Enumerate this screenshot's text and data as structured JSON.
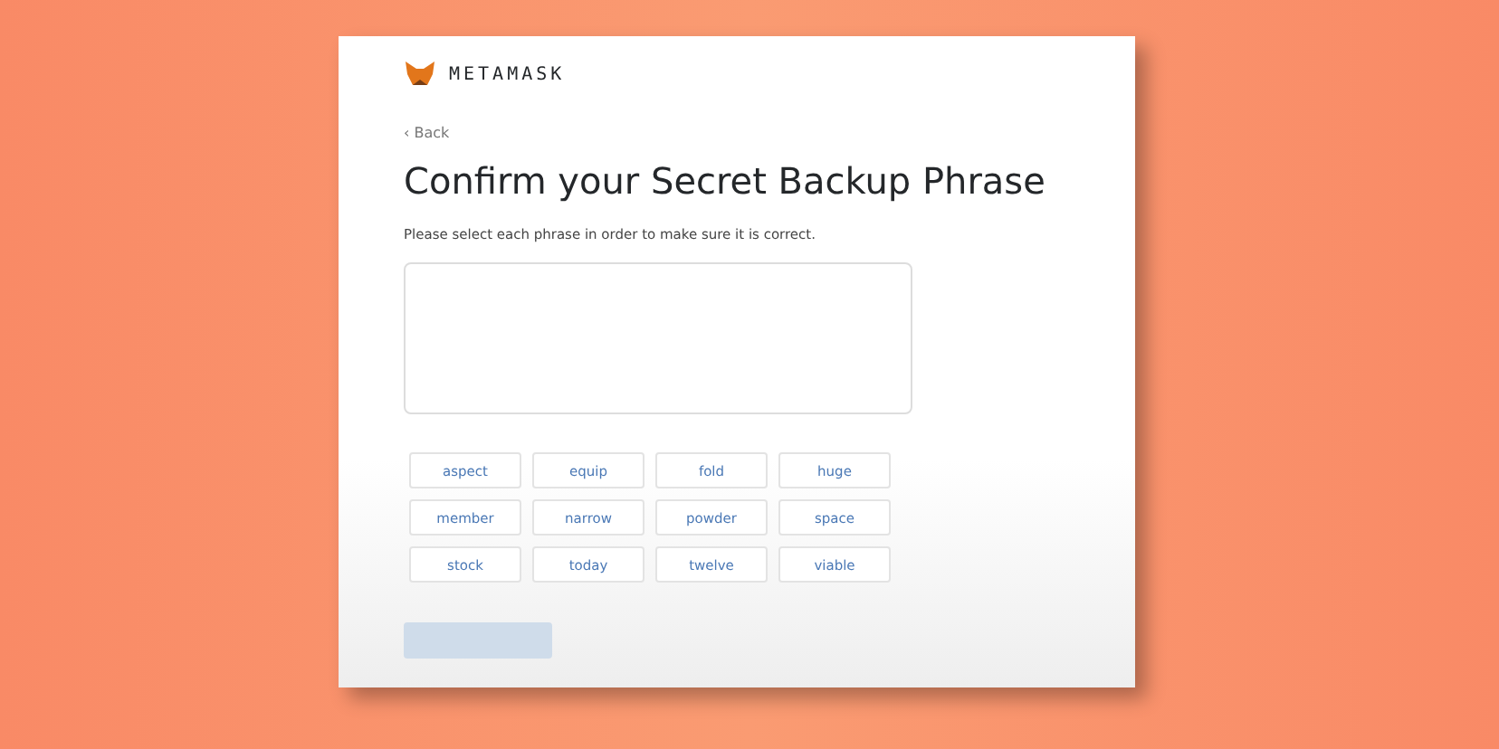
{
  "brand": "METAMASK",
  "back": "‹ Back",
  "title": "Confirm your Secret Backup Phrase",
  "instruction": "Please select each phrase in order to make sure it is correct.",
  "words": [
    "aspect",
    "equip",
    "fold",
    "huge",
    "member",
    "narrow",
    "powder",
    "space",
    "stock",
    "today",
    "twelve",
    "viable"
  ],
  "confirm_button": {
    "disabled": true
  }
}
